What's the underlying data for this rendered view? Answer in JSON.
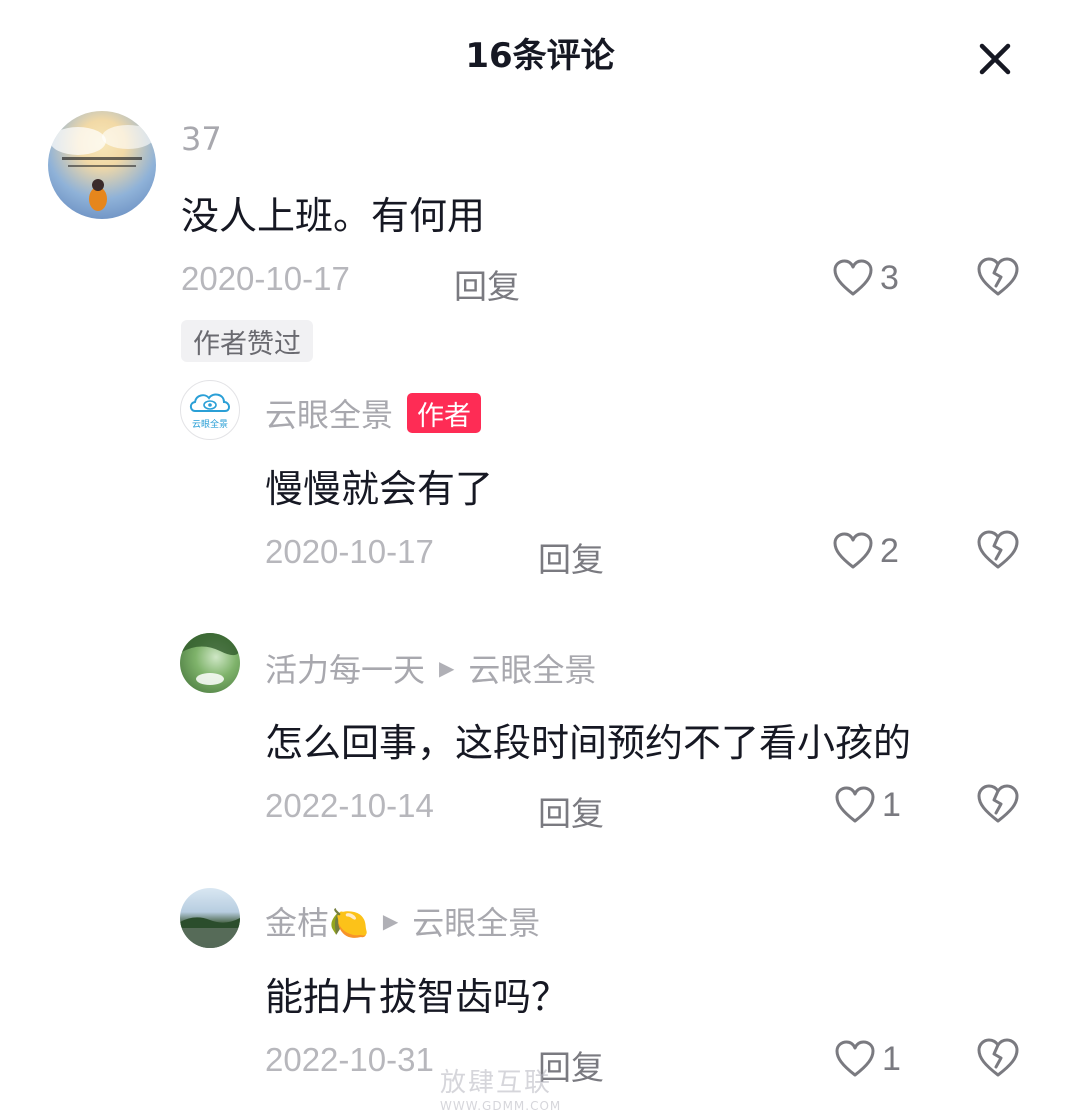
{
  "header": {
    "title": "16条评论"
  },
  "comments": [
    {
      "username": "37",
      "text": "没人上班。有何用",
      "date": "2020-10-17",
      "reply_label": "回复",
      "likes": "3",
      "author_liked_label": "作者赞过"
    },
    {
      "username": "云眼全景",
      "author_badge": "作者",
      "avatar_text": "云眼全景",
      "text": "慢慢就会有了",
      "date": "2020-10-17",
      "reply_label": "回复",
      "likes": "2"
    },
    {
      "username": "活力每一天",
      "reply_to": "云眼全景",
      "text": "怎么回事，这段时间预约不了看小孩的",
      "date": "2022-10-14",
      "reply_label": "回复",
      "likes": "1"
    },
    {
      "username": "金桔🍋",
      "reply_to": "云眼全景",
      "text": "能拍片拔智齿吗？",
      "date": "2022-10-31",
      "reply_label": "回复",
      "likes": "1"
    }
  ],
  "colors": {
    "accent": "#fe2c55",
    "text": "#161823",
    "muted": "#a8a8ae"
  },
  "watermark": {
    "line1": "放肆互联",
    "line2": "WWW.GDMM.COM"
  }
}
